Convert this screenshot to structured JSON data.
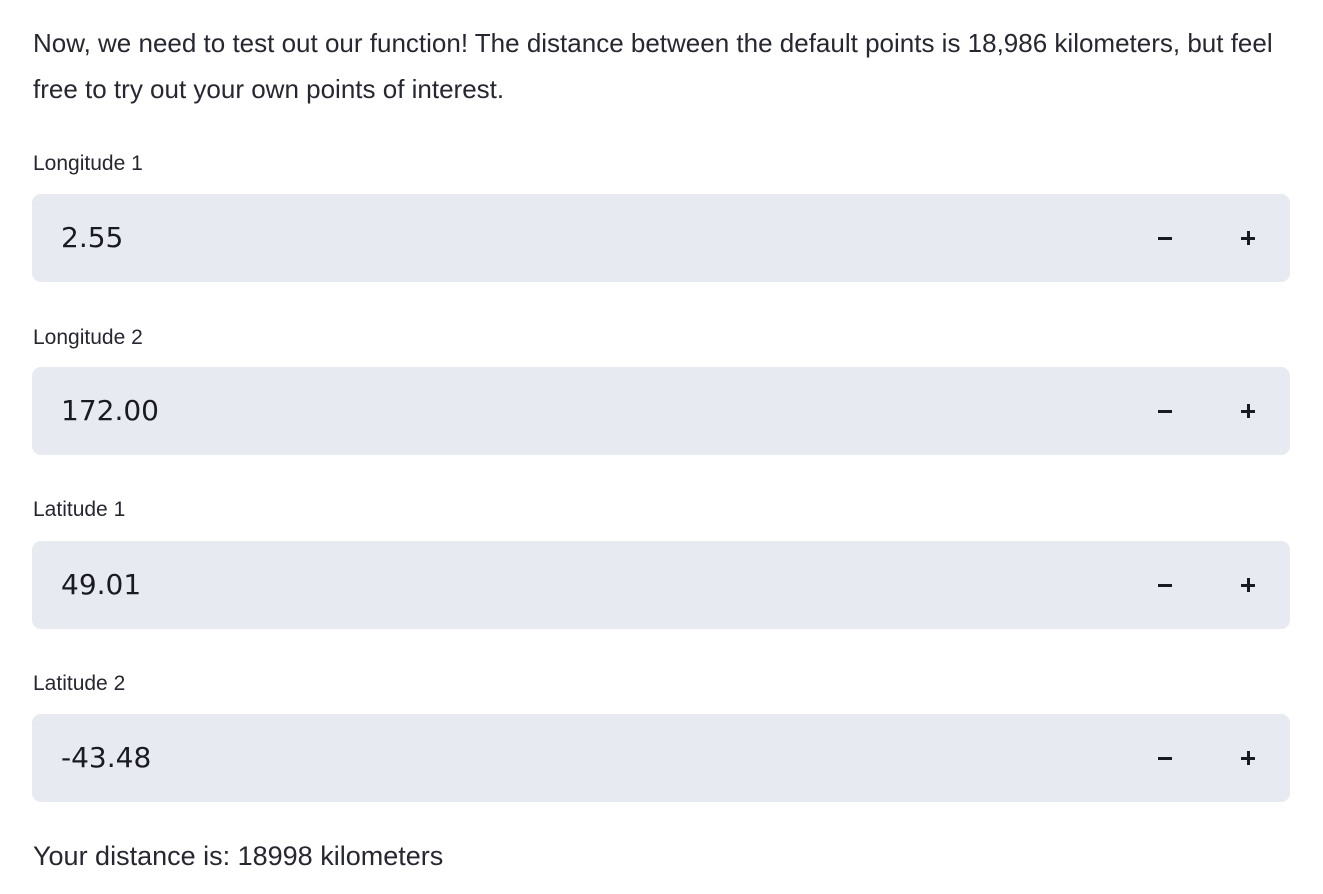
{
  "intro_text": "Now, we need to test out our function! The distance between the default points is 18,986 kilometers, but feel free to try out your own points of interest.",
  "fields": [
    {
      "label": "Longitude 1",
      "value": "2.55",
      "minus_icon": "minus-icon",
      "plus_icon": "plus-icon"
    },
    {
      "label": "Longitude 2",
      "value": "172.00",
      "minus_icon": "minus-icon",
      "plus_icon": "plus-icon"
    },
    {
      "label": "Latitude 1",
      "value": "49.01",
      "minus_icon": "minus-icon",
      "plus_icon": "plus-icon"
    },
    {
      "label": "Latitude 2",
      "value": "-43.48",
      "minus_icon": "minus-icon",
      "plus_icon": "plus-icon"
    }
  ],
  "result_text": "Your distance is: 18998 kilometers",
  "colors": {
    "input_background": "#e8eaf1",
    "text": "#262730"
  }
}
